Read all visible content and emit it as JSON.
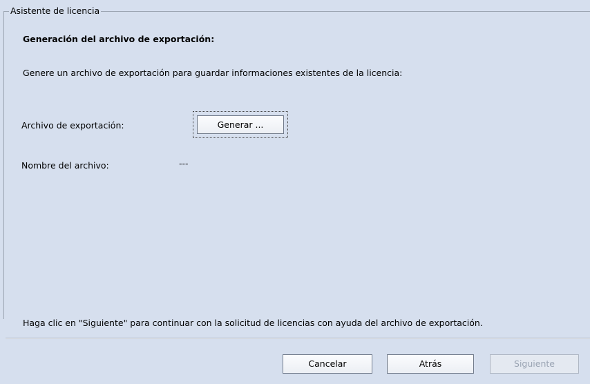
{
  "window": {
    "group_title": "Asistente de licencia"
  },
  "main": {
    "section_title": "Generación del archivo de exportación:",
    "intro_text": "Genere un archivo de exportación para guardar informaciones existentes de la licencia:",
    "export_label": "Archivo de exportación:",
    "generate_button": "Generar ...",
    "filename_label": "Nombre del archivo:",
    "filename_value": "---",
    "hint_text": "Haga clic en \"Siguiente\" para continuar con la solicitud de licencias con ayuda del archivo de exportación."
  },
  "footer": {
    "cancel_label": "Cancelar",
    "back_label": "Atrás",
    "next_label": "Siguiente",
    "next_enabled": false
  },
  "colors": {
    "panel_background": "#d6dfee",
    "border": "#9aa3b0",
    "disabled_text": "#9aa4b3"
  }
}
